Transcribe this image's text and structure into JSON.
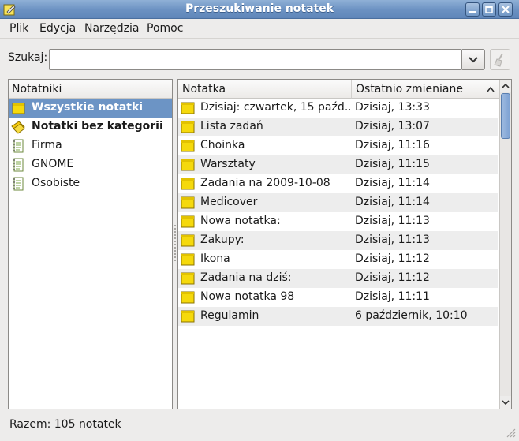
{
  "window": {
    "title": "Przeszukiwanie notatek"
  },
  "titlebar_buttons": {
    "minimize_icon": "minimize-icon",
    "maximize_icon": "maximize-icon",
    "close_icon": "close-icon"
  },
  "menu": [
    {
      "label": "Plik"
    },
    {
      "label": "Edycja"
    },
    {
      "label": "Narzędzia"
    },
    {
      "label": "Pomoc"
    }
  ],
  "search": {
    "label": "Szukaj:",
    "value": "",
    "placeholder": ""
  },
  "notebooks": {
    "header": "Notatniki",
    "items": [
      {
        "label": "Wszystkie notatki",
        "icon": "all-notes-icon",
        "bold": true,
        "selected": true
      },
      {
        "label": "Notatki bez kategorii",
        "icon": "uncategorized-icon",
        "bold": true,
        "selected": false
      },
      {
        "label": "Firma",
        "icon": "notebook-icon",
        "bold": false,
        "selected": false
      },
      {
        "label": "GNOME",
        "icon": "notebook-icon",
        "bold": false,
        "selected": false
      },
      {
        "label": "Osobiste",
        "icon": "notebook-icon",
        "bold": false,
        "selected": false
      }
    ]
  },
  "notes": {
    "columns": {
      "title": "Notatka",
      "changed": "Ostatnio zmieniane"
    },
    "rows": [
      {
        "title": "Dzisiaj: czwartek, 15 paźd…",
        "changed": "Dzisiaj, 13:33"
      },
      {
        "title": "Lista zadań",
        "changed": "Dzisiaj, 13:07"
      },
      {
        "title": "Choinka",
        "changed": "Dzisiaj, 11:16"
      },
      {
        "title": "Warsztaty",
        "changed": "Dzisiaj, 11:15"
      },
      {
        "title": "Zadania na 2009-10-08",
        "changed": "Dzisiaj, 11:14"
      },
      {
        "title": "Medicover",
        "changed": "Dzisiaj, 11:14"
      },
      {
        "title": "Nowa notatka:",
        "changed": "Dzisiaj, 11:13"
      },
      {
        "title": "Zakupy:",
        "changed": "Dzisiaj, 11:13"
      },
      {
        "title": "Ikona",
        "changed": "Dzisiaj, 11:12"
      },
      {
        "title": "Zadania na dziś:",
        "changed": "Dzisiaj, 11:12"
      },
      {
        "title": "Nowa notatka 98",
        "changed": "Dzisiaj, 11:11"
      },
      {
        "title": "Regulamin",
        "changed": "6 październik, 10:10"
      }
    ]
  },
  "status": {
    "text": "Razem: 105 notatek"
  },
  "colors": {
    "selection": "#6c94c5",
    "titlebar": "#6b91c2",
    "note_yellow": "#f5d90c",
    "alt_row": "#ededed"
  }
}
